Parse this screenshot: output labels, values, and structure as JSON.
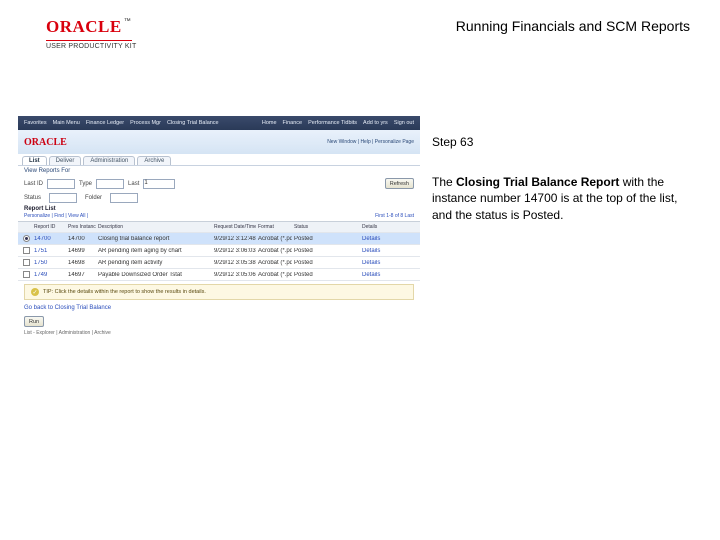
{
  "header": {
    "logo_text": "ORACLE",
    "logo_tm": "™",
    "logo_subtitle": "USER PRODUCTIVITY KIT",
    "page_title": "Running Financials and SCM Reports"
  },
  "right": {
    "step_label": "Step 63",
    "body_pre": "The ",
    "body_bold": "Closing Trial Balance Report",
    "body_post": " with the instance number 14700 is at the top of the list, and the status is Posted."
  },
  "shot": {
    "topbar_items": [
      "Favorites",
      "Main Menu",
      "Finance Ledger",
      "Process Mgr",
      "Closing Trial Balance",
      "Home",
      "Finance",
      "Performance Tidbits",
      "Add to yrs",
      "Sign out"
    ],
    "strip_logo": "ORACLE",
    "crumb_line1": "New Window | Help | Personalize Page",
    "tabs": [
      "List",
      "Deliver",
      "Administration",
      "Archive"
    ],
    "section_title": "View Reports For",
    "filter_labels": {
      "lastid": "Last ID",
      "type": "Type",
      "last": "Last",
      "status": "Status",
      "folder": "Folder"
    },
    "filter_values": {
      "lastid": "",
      "type": "",
      "last": "1",
      "status": "",
      "folder": ""
    },
    "refresh_btn": "Refresh",
    "report_list_label": "Report List",
    "meta_left": "Personalize | Find | View All |",
    "meta_right": "First 1-8 of 8 Last",
    "columns": [
      "",
      "Report ID",
      "Pres Instance",
      "Description",
      "Request Date/Time",
      "Format",
      "Status",
      "",
      "Details"
    ],
    "rows": [
      {
        "select": "radio_on",
        "id": "14700",
        "inst": "14700",
        "desc": "Closing trial balance report",
        "dt": "9/29/12 3:12:48PM",
        "fmt": "Acrobat (*.pdf)",
        "status": "Posted",
        "details": "Details"
      },
      {
        "select": "cb",
        "id": "1751",
        "inst": "14699",
        "desc": "AR pending item aging by chart",
        "dt": "9/29/12 3:06:03PM",
        "fmt": "Acrobat (*.pdf)",
        "status": "Posted",
        "details": "Details"
      },
      {
        "select": "cb",
        "id": "1750",
        "inst": "14698",
        "desc": "AR pending item activity",
        "dt": "9/29/12 3:05:38PM",
        "fmt": "Acrobat (*.pdf)",
        "status": "Posted",
        "details": "Details"
      },
      {
        "select": "cb",
        "id": "1749",
        "inst": "14697",
        "desc": "Payable Downsized Order Tstat",
        "dt": "9/29/12 3:05:06PM",
        "fmt": "Acrobat (*.pdf)",
        "status": "Posted",
        "details": "Details"
      }
    ],
    "tip_text": "TIP: Click the details within the report to show the results in details.",
    "goback_link": "Go back to Closing Trial Balance",
    "run_btn": "Run",
    "footnote": "List - Explorer | Administration | Archive"
  }
}
